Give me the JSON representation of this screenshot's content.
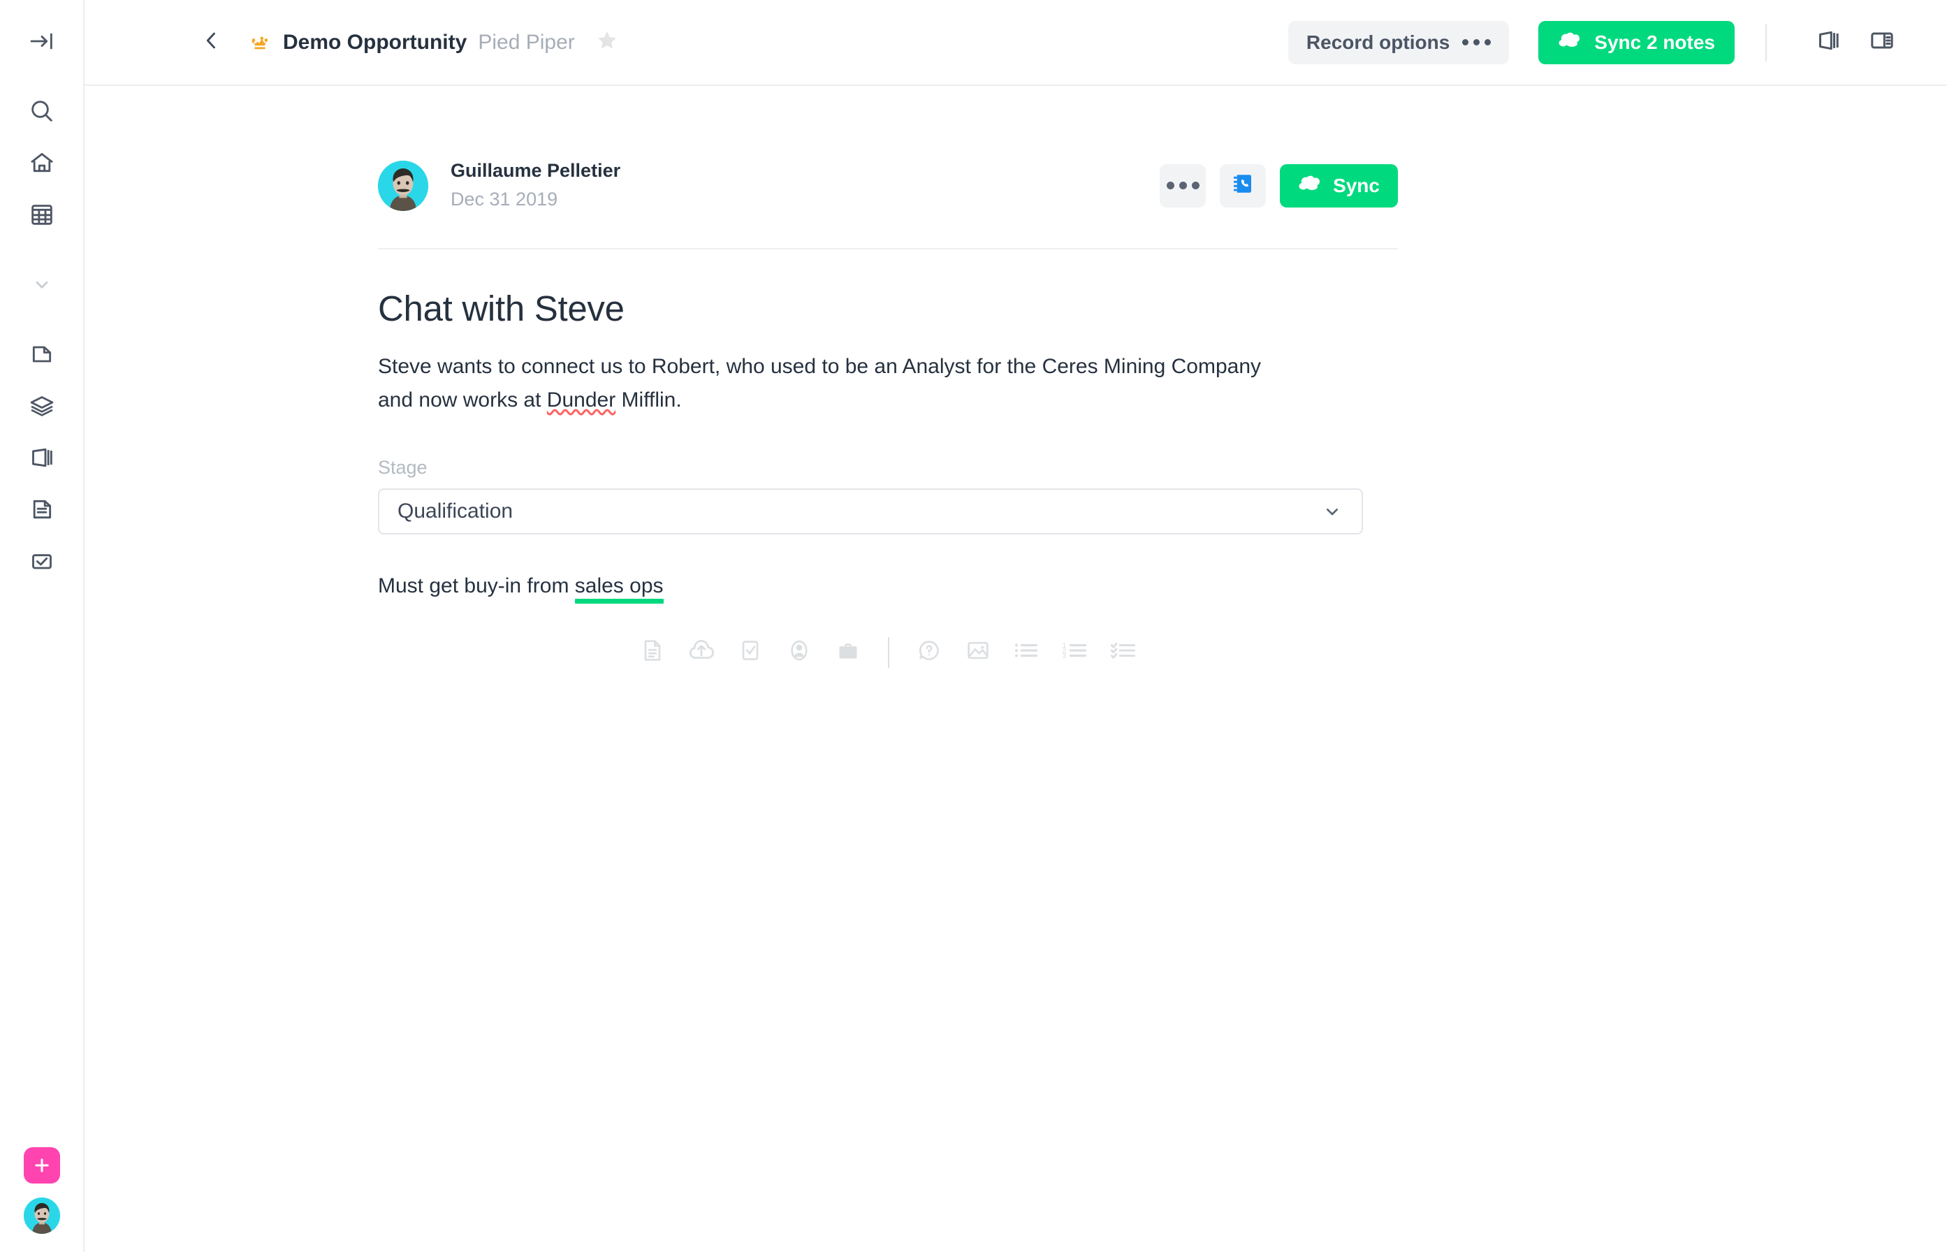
{
  "sidebar": {
    "collapse": {
      "label": "Collapse sidebar",
      "icon": "collapse-arrow-icon"
    },
    "items": [
      {
        "label": "Search",
        "icon": "search-icon"
      },
      {
        "label": "Home",
        "icon": "home-icon"
      },
      {
        "label": "Grid",
        "icon": "grid-icon"
      },
      {
        "label": "Expand",
        "icon": "chevron-down-icon"
      },
      {
        "label": "Page",
        "icon": "page-icon"
      },
      {
        "label": "Layers",
        "icon": "layers-icon"
      },
      {
        "label": "Book",
        "icon": "book-icon"
      },
      {
        "label": "Document",
        "icon": "document-icon"
      },
      {
        "label": "Tasks",
        "icon": "checkbox-icon"
      }
    ],
    "add_button": {
      "label": "+",
      "icon": "plus-icon",
      "color": "#ff44b0"
    },
    "user_avatar": {
      "label": "Guillaume Pelletier",
      "bg": "#2ad7e8"
    }
  },
  "topbar": {
    "back_label": "Back",
    "crown_icon": "crown-icon",
    "crown_color": "#f5a623",
    "record_title": "Demo Opportunity",
    "record_account": "Pied Piper",
    "star_icon": "star-icon",
    "record_options_label": "Record options",
    "sync_notes_label": "Sync 2 notes",
    "sync_notes_color": "#00d97e",
    "panel_icons": [
      "book-panel-icon",
      "split-panel-icon"
    ]
  },
  "note": {
    "author": "Guillaume Pelletier",
    "date": "Dec 31 2019",
    "more_label": "More options",
    "contact_icon": "address-book-phone-icon",
    "sync_label": "Sync",
    "sync_color": "#00d97e",
    "title": "Chat with Steve",
    "body_part1": "Steve wants to connect us to Robert, who used to be an Analyst for the Ceres Mining Company and now works at ",
    "body_spellcheck": "Dunder",
    "body_part2": " Mifflin.",
    "field": {
      "label": "Stage",
      "value": "Qualification",
      "chevron_icon": "chevron-down-icon"
    },
    "line_prefix": "Must get buy-in from ",
    "line_highlight": "sales ops",
    "highlight_color": "#00d97e"
  },
  "toolbar": {
    "items": [
      {
        "label": "Insert note template",
        "icon": "document-lines-icon"
      },
      {
        "label": "Upload file",
        "icon": "cloud-upload-icon"
      },
      {
        "label": "Task",
        "icon": "checkbox-icon"
      },
      {
        "label": "Contact",
        "icon": "person-icon"
      },
      {
        "label": "Opportunity",
        "icon": "briefcase-icon"
      },
      {
        "label": "Divider",
        "icon": "separator"
      },
      {
        "label": "Question",
        "icon": "question-bubble-icon"
      },
      {
        "label": "Image",
        "icon": "image-icon"
      },
      {
        "label": "Bullet list",
        "icon": "bullet-list-icon"
      },
      {
        "label": "Numbered list",
        "icon": "numbered-list-icon"
      },
      {
        "label": "Checklist",
        "icon": "checklist-icon"
      }
    ]
  }
}
